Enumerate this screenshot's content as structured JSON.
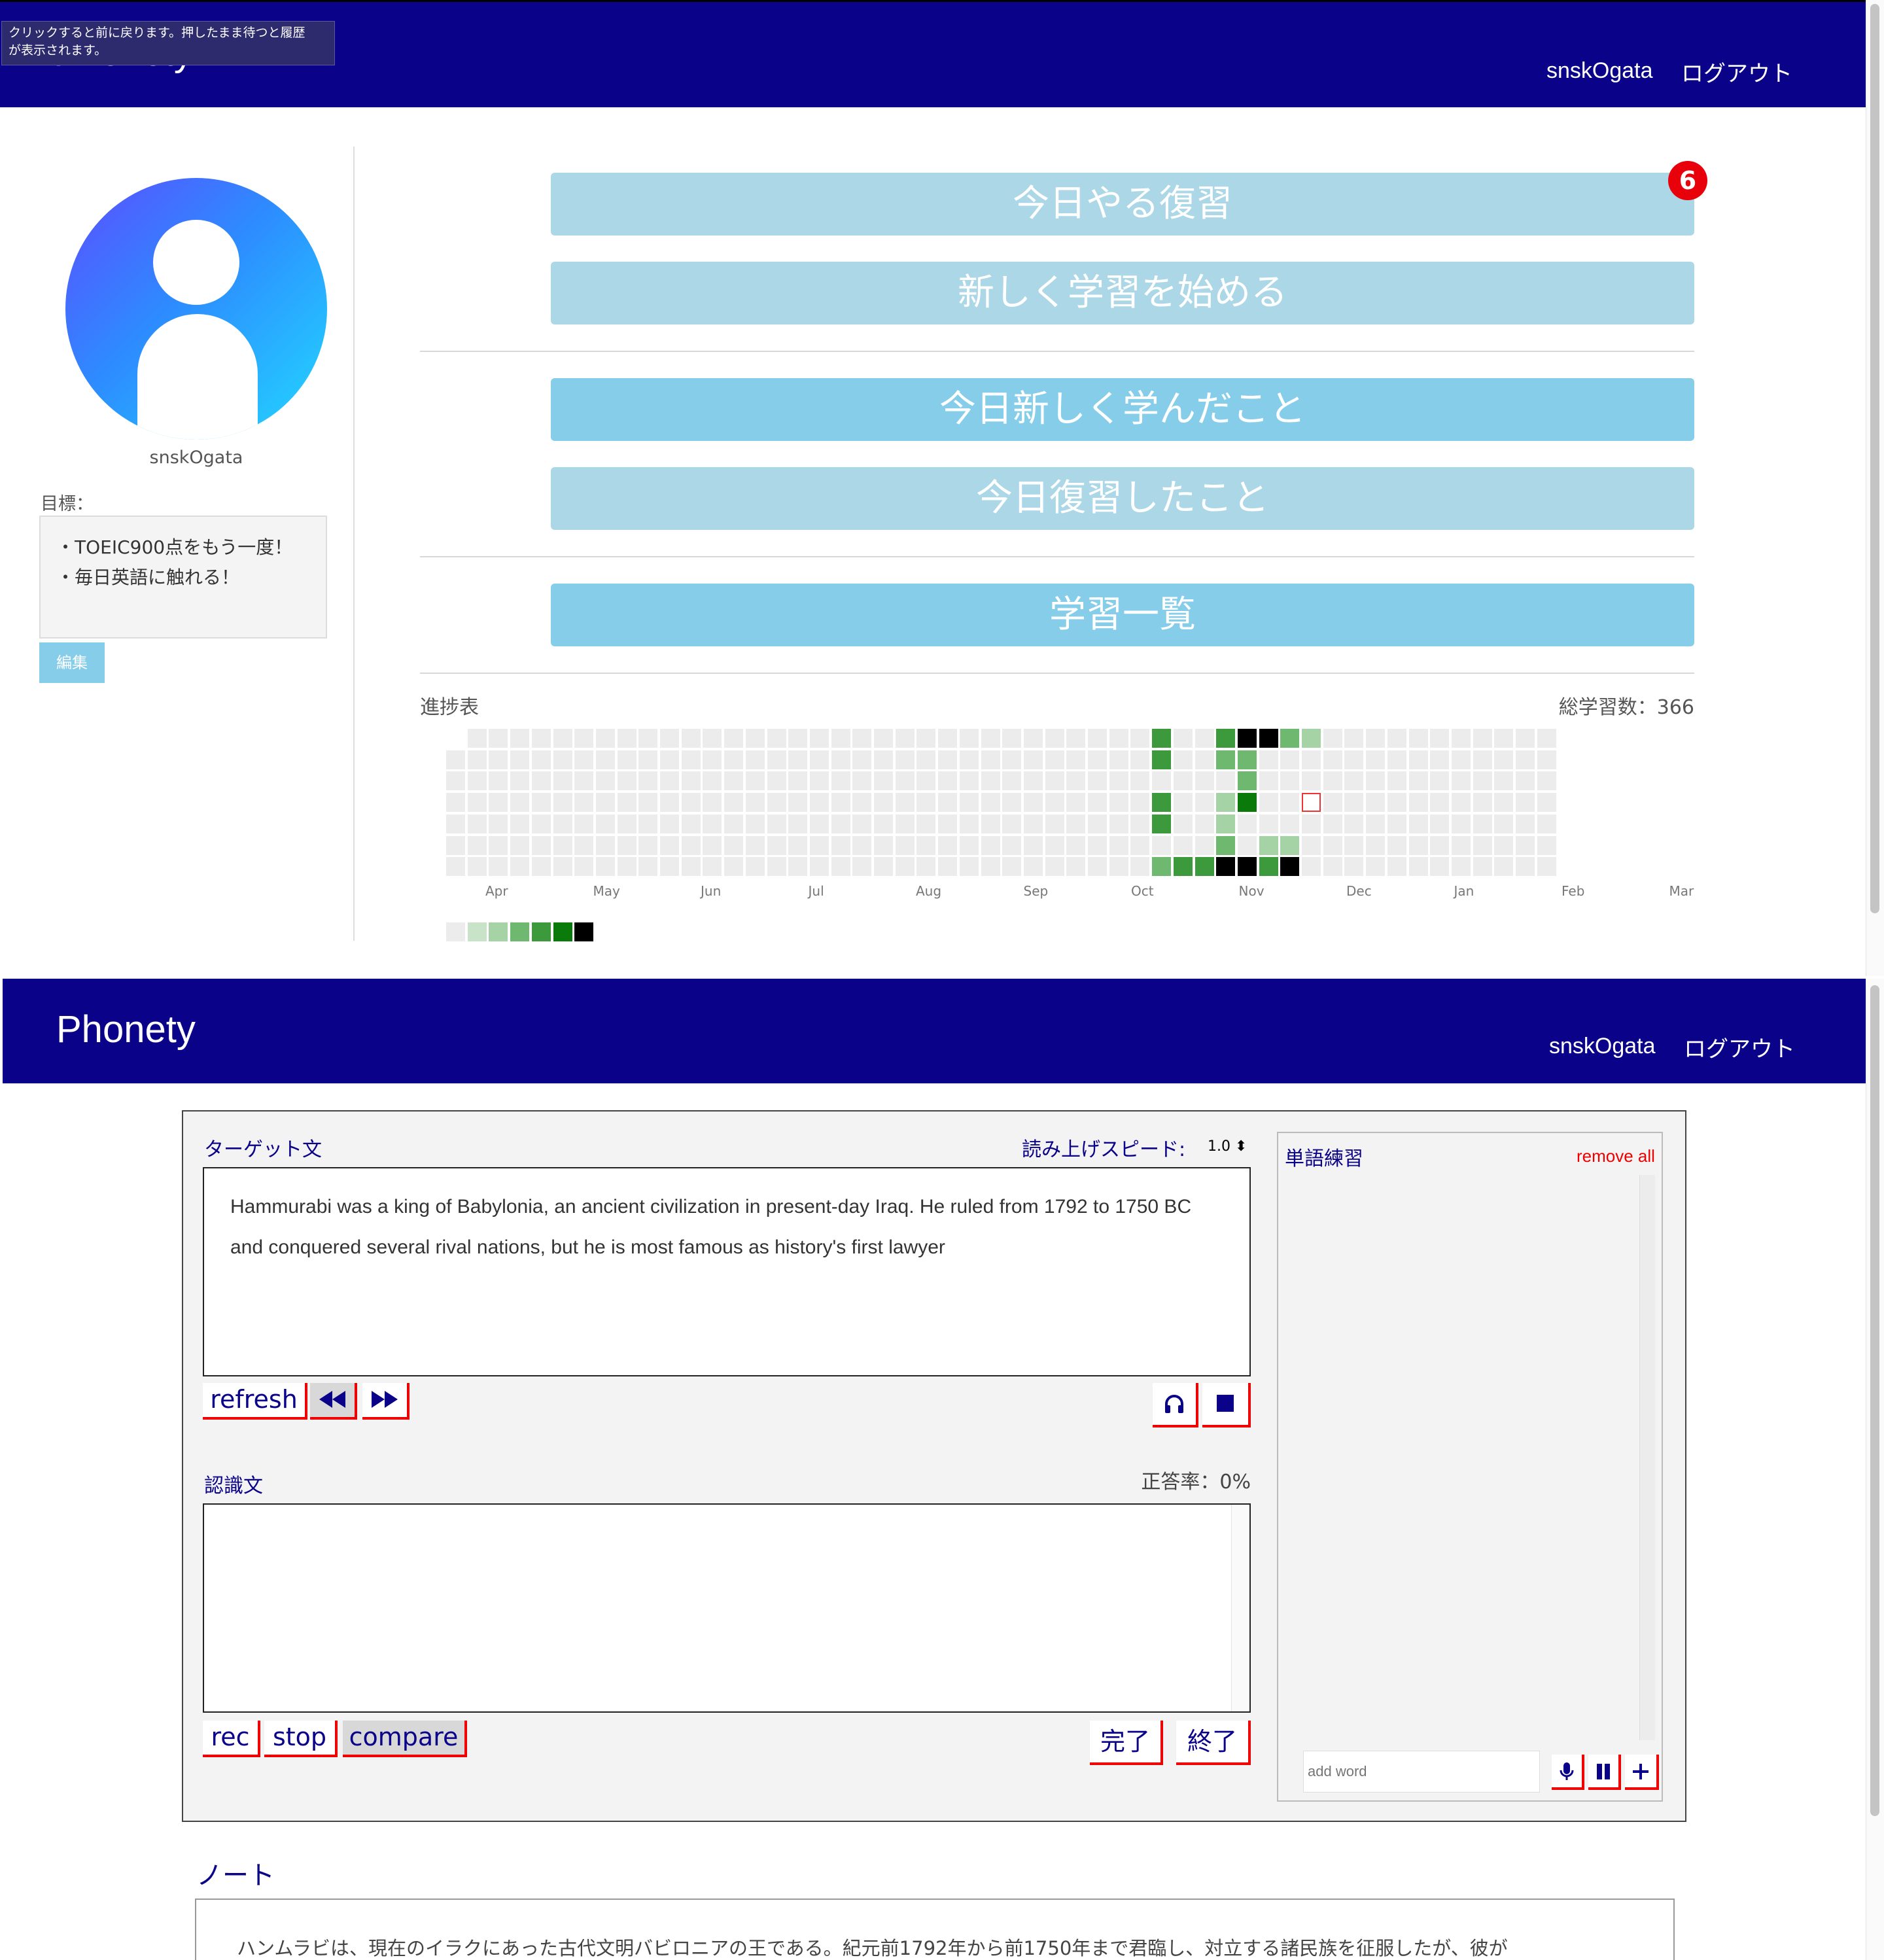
{
  "top_header": {
    "logo": "Phonety",
    "user": "snskOgata",
    "logout": "ログアウト"
  },
  "tooltip": {
    "line1": "クリックすると前に戻ります。押したまま待つと履歴",
    "line2": "が表示されます。"
  },
  "profile": {
    "username": "snskOgata",
    "goal_label": "目標：",
    "goals": [
      "・TOEIC900点をもう一度！",
      "・毎日英語に触れる！"
    ],
    "edit_label": "編集"
  },
  "menu": {
    "review_today": "今日やる復習",
    "review_badge": "6",
    "start_new": "新しく学習を始める",
    "learned_today": "今日新しく学んだこと",
    "reviewed_today": "今日復習したこと",
    "study_list": "学習一覧"
  },
  "progress": {
    "title": "進捗表",
    "total": "総学習数：366",
    "months": [
      "Apr",
      "May",
      "Jun",
      "Jul",
      "Aug",
      "Sep",
      "Oct",
      "Nov",
      "Dec",
      "Jan",
      "Feb",
      "Mar"
    ],
    "legend_colors": [
      "#ececec",
      "#c8e3c8",
      "#a6d3a6",
      "#6fb86f",
      "#3c9a3c",
      "#0a7a0a",
      "#000000"
    ]
  },
  "bottom_header": {
    "logo": "Phonety",
    "user": "snskOgata",
    "logout": "ログアウト"
  },
  "practice": {
    "target_label": "ターゲット文",
    "speed_label": "読み上げスピード:",
    "speed_value": "1.0 ⬍",
    "target_text": "Hammurabi was a king of Babylonia, an ancient civilization in present-day Iraq. He ruled from 1792 to 1750 BC and conquered several rival nations, but he is most famous as history's first lawyer",
    "refresh": "refresh",
    "recognized_label": "認識文",
    "accuracy": "正答率：0%",
    "rec": "rec",
    "stop": "stop",
    "compare": "compare",
    "done": "完了",
    "end": "終了"
  },
  "word_practice": {
    "title": "単語練習",
    "remove_all": "remove all",
    "add_placeholder": "add word"
  },
  "note": {
    "title": "ノート",
    "text": "ハンムラビは、現在のイラクにあった古代文明バビロニアの王である。紀元前1792年から前1750年まで君臨し、対立する諸民族を征服したが、彼が"
  }
}
